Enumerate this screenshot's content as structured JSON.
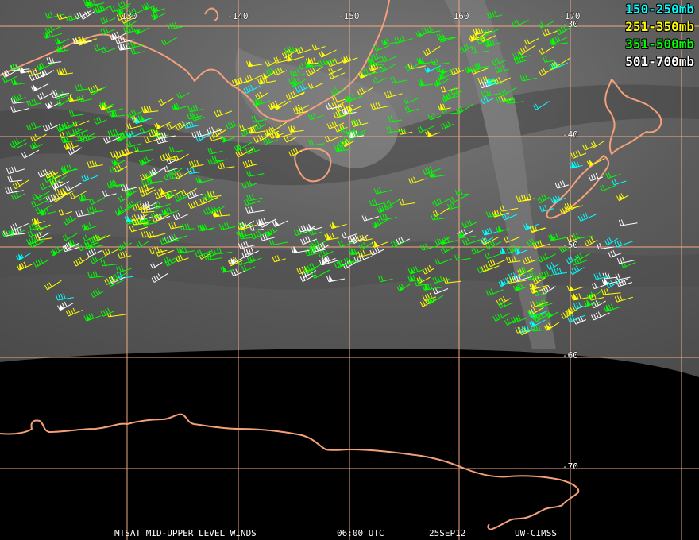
{
  "longitude_labels": [
    "-130",
    "-140",
    "-150",
    "-160",
    "-170"
  ],
  "latitude_labels": [
    "-30",
    "-40",
    "-50",
    "-60",
    "-70"
  ],
  "legend": [
    {
      "label": "150-250mb",
      "color": "#00ffff"
    },
    {
      "label": "251-350mb",
      "color": "#ffff00"
    },
    {
      "label": "351-500mb",
      "color": "#00ff00"
    },
    {
      "label": "501-700mb",
      "color": "#ffffff"
    }
  ],
  "footer": {
    "product": "MTSAT MID-UPPER LEVEL WINDS",
    "time": "06:00 UTC",
    "date": "25SEP12",
    "source": "UW-CIMSS"
  },
  "colors": {
    "coastline": "#f4a07a",
    "grid": "#f0a882",
    "background_space": "#000000",
    "water_vapor_base": "#6e6e6e"
  }
}
